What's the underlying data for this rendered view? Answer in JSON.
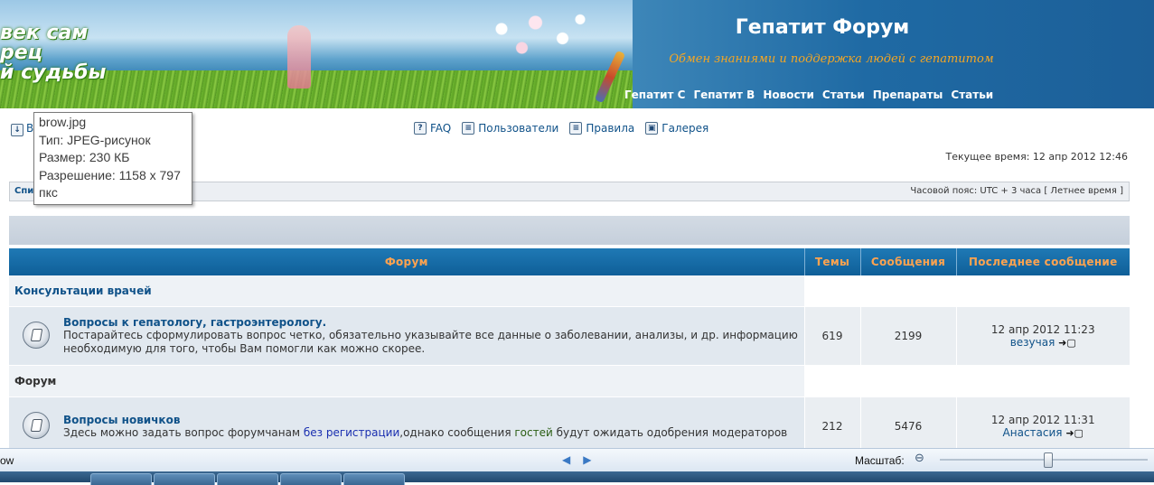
{
  "banner": {
    "slogan_lines": [
      "век сам",
      "рец",
      "й судьбы"
    ],
    "site_title": "Гепатит Форум",
    "site_description": "Обмен знаниями и поддержка людей с гепатитом",
    "nav": [
      "Гепатит С",
      "Гепатит В",
      "Новости",
      "Статьи",
      "Препараты",
      "Статьи"
    ]
  },
  "links": {
    "left_link": "В",
    "faq": "FAQ",
    "users": "Пользователи",
    "rules": "Правила",
    "gallery": "Галерея"
  },
  "current_time": "Текущее время: 12 апр 2012 12:46",
  "tz_bar": {
    "crumb": "Спи",
    "timezone": "Часовой пояс: UTC + 3 часа [ Летнее время ]"
  },
  "tooltip": {
    "lines": [
      "brow.jpg",
      "Тип: JPEG-рисунок",
      "Размер: 230 КБ",
      "Разрешение: 1158 x 797",
      "пкс"
    ]
  },
  "table": {
    "headers": {
      "forum": "Форум",
      "topics": "Темы",
      "posts": "Сообщения",
      "last": "Последнее сообщение"
    },
    "categories": [
      {
        "name": "Консультации врачей",
        "forums": [
          {
            "title": "Вопросы к гепатологу, гастроэнтерологу.",
            "desc_plain": "Постарайтесь сформулировать вопрос четко, обязательно указывайте все данные о заболевании, анализы, и др. информацию необходимую для того, чтобы Вам помогли как можно скорее.",
            "topics": "619",
            "posts": "2199",
            "last_date": "12 апр 2012 11:23",
            "last_user": "везучая"
          }
        ]
      },
      {
        "name": "Форум",
        "forums": [
          {
            "title": "Вопросы новичков",
            "desc_part1": "Здесь можно задать вопрос форумчанам ",
            "desc_link1": "без регистрации",
            "desc_part2": ",однако сообщения ",
            "desc_link2": "гостей",
            "desc_part3": " будут ожидать одобрения модераторов",
            "topics": "212",
            "posts": "5476",
            "last_date": "12 апр 2012 11:31",
            "last_user": "Анастасия"
          }
        ]
      }
    ]
  },
  "viewer": {
    "filename_fragment": "ow",
    "zoom_label": "Масштаб:",
    "zoom_level": 0.52
  },
  "colors": {
    "header_blue": "#1f79b5",
    "header_text": "#ffa34f",
    "link_blue": "#105289",
    "row_bg": "#e1e8ef"
  }
}
